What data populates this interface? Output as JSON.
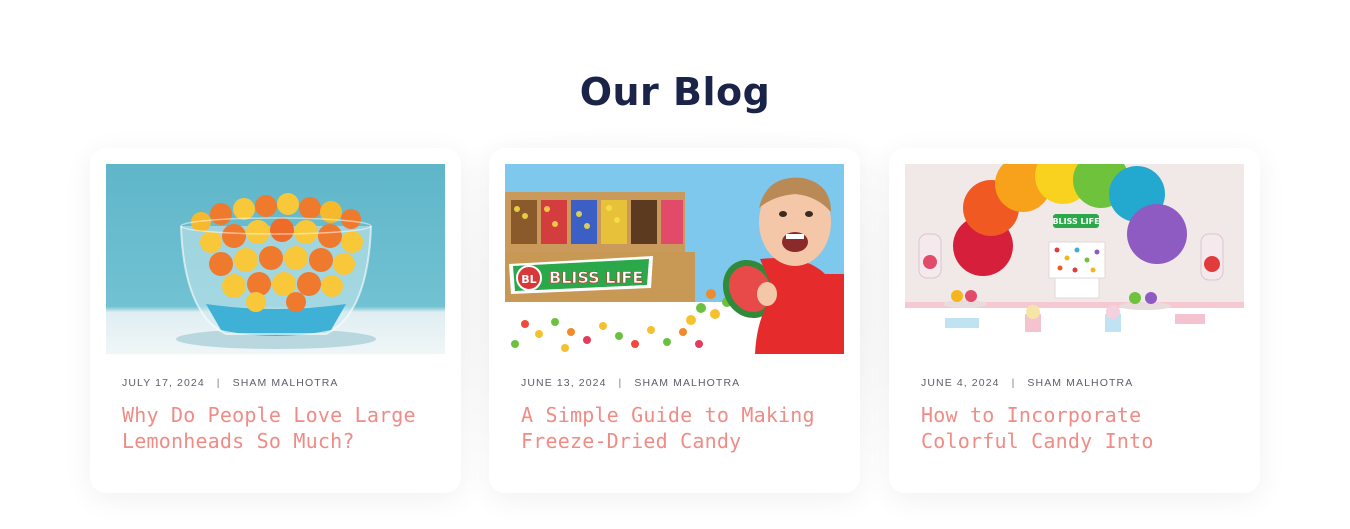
{
  "section": {
    "title": "Our Blog"
  },
  "colors": {
    "title": "#1a2348",
    "post_title": "#ef8c86",
    "meta": "#5b5e6a",
    "card_bg": "#ffffff"
  },
  "posts": [
    {
      "date": "JULY 17, 2024",
      "separator": "|",
      "author": "SHAM MALHOTRA",
      "title": "Why Do People Love Large Lemonheads So Much?",
      "image": "bowl-of-yellow-and-orange-candies"
    },
    {
      "date": "JUNE 13, 2024",
      "separator": "|",
      "author": "SHAM MALHOTRA",
      "title": "A Simple Guide to Making Freeze-Dried Candy",
      "image": "boy-with-candy-bins",
      "image_text": "BLISS LIFE",
      "image_badge": "BL"
    },
    {
      "date": "JUNE 4, 2024",
      "separator": "|",
      "author": "SHAM MALHOTRA",
      "title": "How to Incorporate Colorful Candy Into Events",
      "image": "rainbow-candy-party-table",
      "image_text": "BLISS LIFE"
    }
  ]
}
